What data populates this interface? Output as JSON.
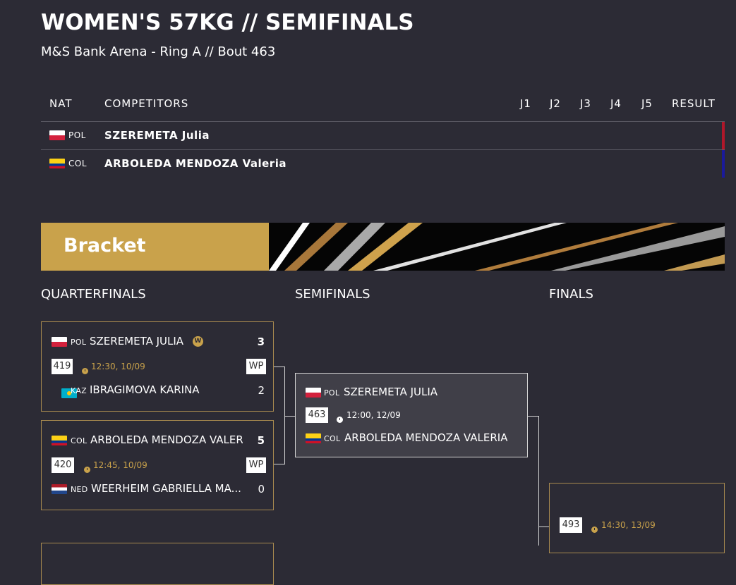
{
  "header": {
    "title": "WOMEN'S 57KG // SEMIFINALS",
    "subtitle": "M&S Bank Arena - Ring A // Bout 463"
  },
  "table": {
    "columns": [
      "NAT",
      "COMPETITORS",
      "J1",
      "J2",
      "J3",
      "J4",
      "J5",
      "RESULT"
    ],
    "rows": [
      {
        "nat": "POL",
        "flag": "poland-flag",
        "name": "SZEREMETA Julia",
        "corner_color": "#b0172a"
      },
      {
        "nat": "COL",
        "flag": "colombia-flag",
        "name": "ARBOLEDA MENDOZA Valeria",
        "corner_color": "#1a1a9c"
      }
    ]
  },
  "bracket": {
    "banner_title": "Bracket",
    "accent_color": "#c9a24b",
    "rounds": [
      "QUARTERFINALS",
      "SEMIFINALS",
      "FINALS"
    ],
    "quarterfinals": [
      {
        "bout": "419",
        "time": "12:30, 10/09",
        "method": "WP",
        "top": {
          "nat": "POL",
          "name": "SZEREMETA JULIA",
          "score": "3",
          "winner_badge": "W"
        },
        "bottom": {
          "nat": "KAZ",
          "name": "IBRAGIMOVA KARINA",
          "score": "2"
        }
      },
      {
        "bout": "420",
        "time": "12:45, 10/09",
        "method": "WP",
        "top": {
          "nat": "COL",
          "name": "ARBOLEDA MENDOZA VALER",
          "score": "5"
        },
        "bottom": {
          "nat": "NED",
          "name": "WEERHEIM GABRIELLA MA...",
          "score": "0"
        }
      }
    ],
    "semifinal": {
      "bout": "463",
      "time": "12:00, 12/09",
      "top": {
        "nat": "POL",
        "name": "SZEREMETA JULIA"
      },
      "bottom": {
        "nat": "COL",
        "name": "ARBOLEDA MENDOZA VALERIA"
      }
    },
    "final": {
      "bout": "493",
      "time": "14:30, 13/09"
    }
  }
}
